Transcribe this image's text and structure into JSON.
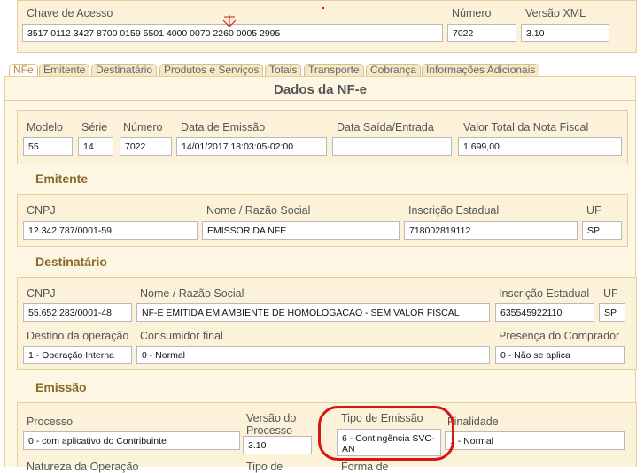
{
  "header": {
    "chave_label": "Chave de Acesso",
    "chave_value": "3517 0112 3427 8700 0159 5501 4000 0070 2260 0005 2995",
    "numero_label": "Número",
    "numero_value": "7022",
    "versao_label": "Versão XML",
    "versao_value": "3.10"
  },
  "tabs": [
    "NFe",
    "Emitente",
    "Destinatário",
    "Produtos e Serviços",
    "Totais",
    "Transporte",
    "Cobrança",
    "Informações Adicionais"
  ],
  "main": {
    "title": "Dados da NF-e"
  },
  "nfe": {
    "modelo_label": "Modelo",
    "modelo_value": "55",
    "serie_label": "Série",
    "serie_value": "14",
    "numero_label": "Número",
    "numero_value": "7022",
    "emissao_label": "Data de Emissão",
    "emissao_value": "14/01/2017 18:03:05-02:00",
    "saida_label": "Data Saída/Entrada",
    "saida_value": "",
    "valor_label": "Valor Total da Nota Fiscal",
    "valor_value": "1.699,00"
  },
  "emitente": {
    "title": "Emitente",
    "cnpj_label": "CNPJ",
    "cnpj_value": "12.342.787/0001-59",
    "nome_label": "Nome / Razão Social",
    "nome_value": "EMISSOR DA NFE",
    "ie_label": "Inscrição Estadual",
    "ie_value": "718002819112",
    "uf_label": "UF",
    "uf_value": "SP"
  },
  "destinatario": {
    "title": "Destinatário",
    "cnpj_label": "CNPJ",
    "cnpj_value": "55.652.283/0001-48",
    "nome_label": "Nome / Razão Social",
    "nome_value": "NF-E EMITIDA EM AMBIENTE DE HOMOLOGACAO - SEM VALOR FISCAL",
    "ie_label": "Inscrição Estadual",
    "ie_value": "635545922110",
    "uf_label": "UF",
    "uf_value": "SP",
    "destino_label": "Destino da operação",
    "destino_value": "1 - Operação Interna",
    "consumidor_label": "Consumidor final",
    "consumidor_value": "0 - Normal",
    "presenca_label": "Presença do Comprador",
    "presenca_value": "0 - Não se aplica"
  },
  "emissao": {
    "title": "Emissão",
    "processo_label": "Processo",
    "processo_value": "0 - com aplicativo do Contribuinte",
    "versao_label_1": "Versão do",
    "versao_label_2": "Processo",
    "versao_value": "3.10",
    "tipo_label": "Tipo de Emissão",
    "tipo_value_1": "6 - Contingência SVC-",
    "tipo_value_2": "AN",
    "finalidade_label": "Finalidade",
    "finalidade_value": "1 - Normal",
    "natureza_label": "Natureza da Operação",
    "tipo2_label": "Tipo de",
    "forma_label": "Forma de"
  },
  "colors": {
    "panel": "#fbf2d9",
    "title": "#8a6a2a",
    "highlight": "#d81515"
  }
}
